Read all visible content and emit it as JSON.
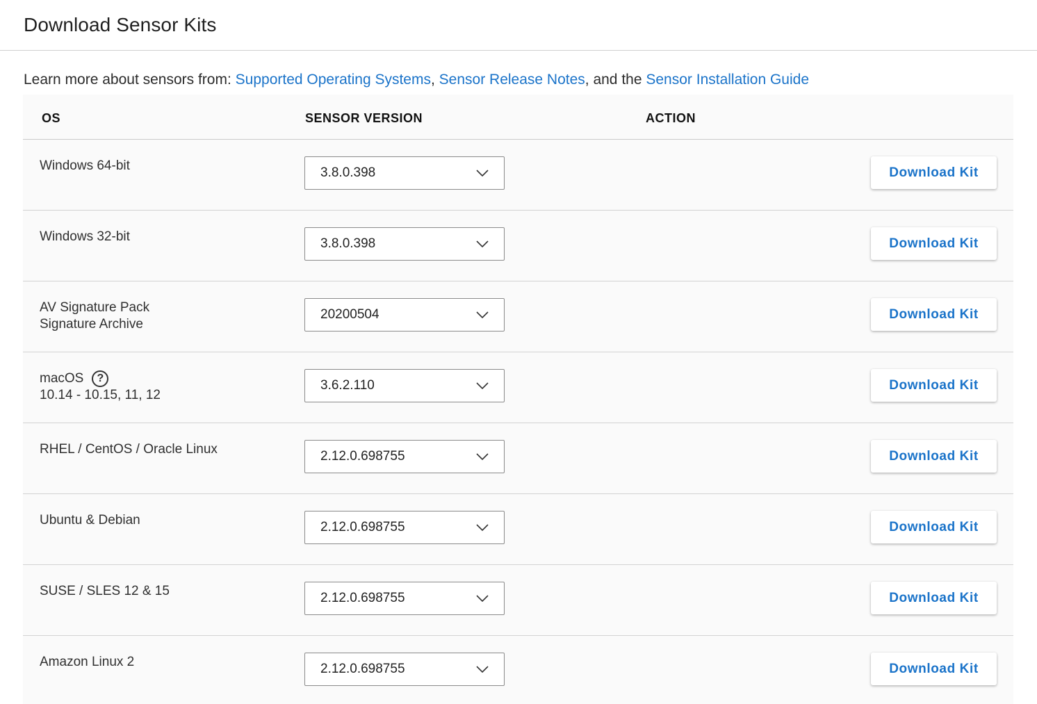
{
  "page": {
    "title": "Download Sensor Kits"
  },
  "intro": {
    "prefix": "Learn more about sensors from: ",
    "link1": "Supported Operating Systems",
    "sep1": ", ",
    "link2": "Sensor Release Notes",
    "sep2": ", and the ",
    "link3": "Sensor Installation Guide"
  },
  "table": {
    "headers": {
      "os": "OS",
      "version": "SENSOR VERSION",
      "action": "ACTION"
    },
    "rows": [
      {
        "os": "Windows 64-bit",
        "os2": "",
        "version": "3.8.0.398",
        "action": "Download Kit"
      },
      {
        "os": "Windows 32-bit",
        "os2": "",
        "version": "3.8.0.398",
        "action": "Download Kit"
      },
      {
        "os": "AV Signature Pack",
        "os2": "Signature Archive",
        "version": "20200504",
        "action": "Download Kit"
      },
      {
        "os": "macOS",
        "os2": "10.14 - 10.15, 11, 12",
        "help": "?",
        "version": "3.6.2.110",
        "action": "Download Kit"
      },
      {
        "os": "RHEL / CentOS / Oracle Linux",
        "os2": "",
        "version": "2.12.0.698755",
        "action": "Download Kit"
      },
      {
        "os": "Ubuntu & Debian",
        "os2": "",
        "version": "2.12.0.698755",
        "action": "Download Kit"
      },
      {
        "os": "SUSE / SLES 12 & 15",
        "os2": "",
        "version": "2.12.0.698755",
        "action": "Download Kit"
      },
      {
        "os": "Amazon Linux 2",
        "os2": "",
        "version": "2.12.0.698755",
        "action": "Download Kit"
      }
    ]
  },
  "colors": {
    "link": "#1a73c9",
    "text": "#2b2b2b",
    "table_bg": "#fafafa"
  }
}
